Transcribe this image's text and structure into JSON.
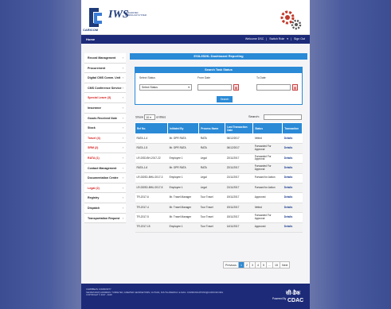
{
  "header": {
    "logo1_text": "CARICOM",
    "logo2_text": "IWS",
    "logo2_sub": "INTEGRATED WORKFLOW SYSTEM"
  },
  "navbar": {
    "home": "Home",
    "welcome": "Welcome DSC",
    "switch_role": "Switch Role",
    "sign_out": "Sign Out"
  },
  "sidebar": {
    "items": [
      {
        "label": "Record Management",
        "red": false
      },
      {
        "label": "Procurement",
        "red": false
      },
      {
        "label": "Digital CMS Comm. Unit",
        "red": false
      },
      {
        "label": "CMS Conference Service",
        "red": false
      },
      {
        "label": "Special Leave (3)",
        "red": true
      },
      {
        "label": "Insurance",
        "red": false
      },
      {
        "label": "Goods Received Note",
        "red": false
      },
      {
        "label": "Stock",
        "red": false
      },
      {
        "label": "Travel (4)",
        "red": true
      },
      {
        "label": "SRM (2)",
        "red": true
      },
      {
        "label": "RATA (1)",
        "red": true
      },
      {
        "label": "Contact Management",
        "red": false
      },
      {
        "label": "Documentation Centre",
        "red": false
      },
      {
        "label": "Legal (2)",
        "red": true
      },
      {
        "label": "Registry",
        "red": false
      },
      {
        "label": "Dispatch",
        "red": false
      },
      {
        "label": "Transportation Request",
        "red": false
      }
    ]
  },
  "main": {
    "title": "ESIL/ISIHL Dashboard Reporting",
    "search_panel": {
      "title": "Search Task Status",
      "select_status_label": "Select Status",
      "select_status_value": "Select Status",
      "from_date_label": "From Date",
      "to_date_label": "To Date",
      "search_button": "Search"
    },
    "show_label": "Show",
    "entries_value": "10",
    "entries_label": "entries",
    "search_label": "Search:",
    "table": {
      "columns": [
        "Ref No.",
        "Initiated By",
        "Process Name",
        "Last Transaction Date",
        "Status",
        "Transaction"
      ],
      "rows": [
        [
          "RATA-1-4",
          "Mr. DPR RATA",
          "RATA",
          "06/12/2017",
          "Vetted",
          "Details"
        ],
        [
          "RATA-1-5",
          "Mr. DPR RATA",
          "RATA",
          "06/12/2017",
          "Forwarded For Approval",
          "Details"
        ],
        [
          "LR-DSD-BH-2017-22",
          "Employee 1",
          "Legal",
          "22/11/2017",
          "Forwarded For Approval",
          "Details"
        ],
        [
          "RATA-1-6",
          "Mr. DPR RATA",
          "RATA",
          "22/11/2017",
          "Forwarded For Approval",
          "Details"
        ],
        [
          "LR-DDSD-BHU-2017-3",
          "Employee 1",
          "Legal",
          "21/11/2017",
          "Forward for Action",
          "Details"
        ],
        [
          "LR-DDSD-BHU-2017-5",
          "Employee 1",
          "Legal",
          "21/11/2017",
          "Forward for Action",
          "Details"
        ],
        [
          "TR-2017-6",
          "Mr. Travel Manager",
          "Tour Travel",
          "19/11/2017",
          "Approved",
          "Details"
        ],
        [
          "TR-2017-4",
          "Mr. Travel Manager",
          "Tour Travel",
          "19/11/2017",
          "Vetted",
          "Details"
        ],
        [
          "TR-2017-5",
          "Mr. Travel Manager",
          "Tour Travel",
          "15/11/2017",
          "Forwarded For Approval",
          "Details"
        ],
        [
          "TR-2017-15",
          "Employee 1",
          "Tour Travel",
          "14/11/2017",
          "Approved",
          "Details"
        ]
      ]
    },
    "pagination": [
      "Previous",
      "1",
      "2",
      "3",
      "4",
      "5",
      "...",
      "15",
      "Next"
    ]
  },
  "footer": {
    "line1": "CARIBBEAN COMMUNITY",
    "line2": "SECRETARIAT ADDRESS: TURKEYEN, GREATER GEORGETOWN, GUYANA, SOUTH AMERICA. E-MAIL: COMMUNICATIONS@CARICOM.ORG",
    "line3": "COPYRIGHT © 2017 - 2018",
    "powered_by": "Powered By",
    "cdac_hindi": "सी-डैक",
    "cdac": "CDAC"
  }
}
